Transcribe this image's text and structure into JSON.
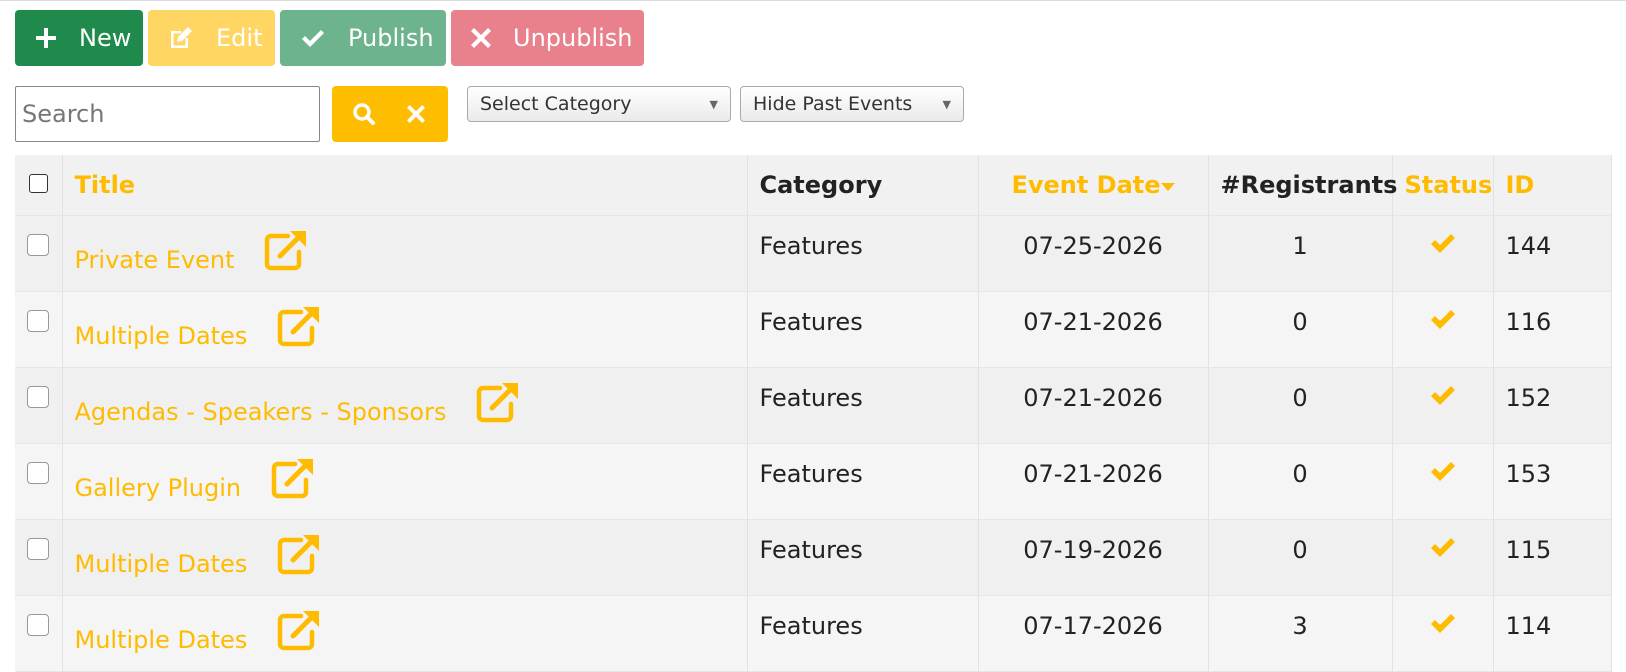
{
  "toolbar": {
    "new_label": "New",
    "edit_label": "Edit",
    "publish_label": "Publish",
    "unpublish_label": "Unpublish"
  },
  "search": {
    "placeholder": "Search",
    "value": ""
  },
  "filters": {
    "category": "Select Category",
    "past_events": "Hide Past Events"
  },
  "table": {
    "headers": {
      "title": "Title",
      "category": "Category",
      "event_date": "Event Date",
      "registrants": "#Registrants",
      "status": "Status",
      "id": "ID"
    },
    "rows": [
      {
        "title": "Private Event",
        "category": "Features",
        "date": "07-25-2026",
        "registrants": "1",
        "id": "144"
      },
      {
        "title": "Multiple Dates",
        "category": "Features",
        "date": "07-21-2026",
        "registrants": "0",
        "id": "116"
      },
      {
        "title": "Agendas - Speakers - Sponsors",
        "category": "Features",
        "date": "07-21-2026",
        "registrants": "0",
        "id": "152"
      },
      {
        "title": "Gallery Plugin",
        "category": "Features",
        "date": "07-21-2026",
        "registrants": "0",
        "id": "153"
      },
      {
        "title": "Multiple Dates",
        "category": "Features",
        "date": "07-19-2026",
        "registrants": "0",
        "id": "115"
      },
      {
        "title": "Multiple Dates",
        "category": "Features",
        "date": "07-17-2026",
        "registrants": "3",
        "id": "114"
      }
    ]
  },
  "icons": {
    "new": "plus-icon",
    "edit": "edit-icon",
    "publish": "check-icon",
    "unpublish": "times-icon",
    "search": "search-icon",
    "clear": "times-icon",
    "external": "external-link-icon",
    "status": "check-icon",
    "sort": "caret-down-icon"
  },
  "colors": {
    "accent": "#ffbb00",
    "new": "#1f8a4c",
    "edit": "#ffd564",
    "publish": "#6db38d",
    "unpublish": "#e9818c"
  }
}
